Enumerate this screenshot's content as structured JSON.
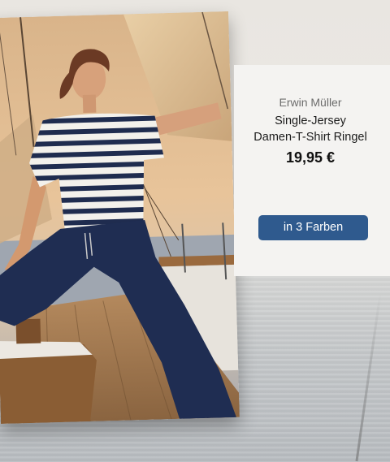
{
  "product": {
    "brand": "Erwin Müller",
    "name_line1": "Single-Jersey",
    "name_line2": "Damen-T-Shirt Ringel",
    "price": "19,95 €",
    "colors_button_label": "in 3 Farben"
  },
  "images": {
    "product_photo": "woman-in-striped-tshirt-on-sailboat",
    "background": "sea-horizon"
  },
  "colors": {
    "button": "#2f5a8e",
    "panel": "#f4f3f1",
    "stripe_navy": "#1f2c4f"
  }
}
